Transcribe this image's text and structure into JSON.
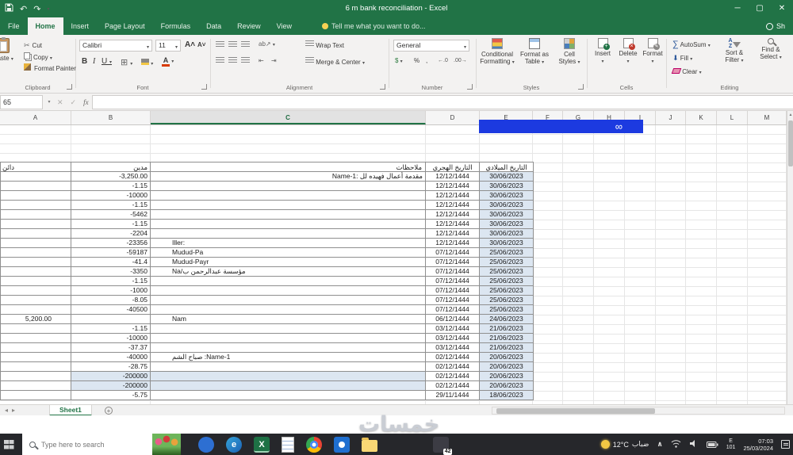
{
  "window": {
    "title": "6 m bank reconciliation - Excel",
    "share": "Sh"
  },
  "tabs": [
    "File",
    "Home",
    "Insert",
    "Page Layout",
    "Formulas",
    "Data",
    "Review",
    "View"
  ],
  "tell_me": "Tell me what you want to do...",
  "ribbon": {
    "clipboard": {
      "group": "Clipboard",
      "paste": "Paste",
      "cut": "Cut",
      "copy": "Copy",
      "format_painter": "Format Painter"
    },
    "font": {
      "group": "Font",
      "name": "Calibri",
      "size": "11"
    },
    "alignment": {
      "group": "Alignment",
      "wrap": "Wrap Text",
      "merge": "Merge & Center"
    },
    "number": {
      "group": "Number",
      "format": "General"
    },
    "styles": {
      "group": "Styles",
      "conditional_1": "Conditional",
      "conditional_2": "Formatting",
      "table_1": "Format as",
      "table_2": "Table",
      "cellstyles_1": "Cell",
      "cellstyles_2": "Styles"
    },
    "cells": {
      "group": "Cells",
      "insert": "Insert",
      "delete": "Delete",
      "format": "Format"
    },
    "editing": {
      "group": "Editing",
      "autosum": "AutoSum",
      "fill": "Fill",
      "clear": "Clear",
      "sort_1": "Sort &",
      "sort_2": "Filter",
      "find_1": "Find &",
      "find_2": "Select"
    }
  },
  "formula_bar": {
    "name_box": "65",
    "fx": "fx"
  },
  "grid": {
    "columns": [
      "A",
      "B",
      "C",
      "D",
      "E",
      "F",
      "G",
      "H",
      "I",
      "J",
      "K",
      "L",
      "M"
    ],
    "selected_column": "C",
    "shape_symbol": "∞",
    "shape_color": "#1c3ae0",
    "header": {
      "a": "دائن",
      "b": "مدين",
      "c": "ملاحظات",
      "d": "التاريخ الهجري",
      "e": "التاريخ الميلادي"
    },
    "rows": [
      {
        "a": "",
        "b": "-3,250.00",
        "c": "مقدمة أعمال فهيده لل :Name-1",
        "c_align": "right",
        "d": "12/12/1444",
        "e": "30/06/2023"
      },
      {
        "b": "-1.15",
        "d": "12/12/1444",
        "e": "30/06/2023"
      },
      {
        "b": "-10000",
        "d": "12/12/1444",
        "e": "30/06/2023"
      },
      {
        "b": "-1.15",
        "d": "12/12/1444",
        "e": "30/06/2023"
      },
      {
        "b": "-5462",
        "d": "12/12/1444",
        "e": "30/06/2023"
      },
      {
        "b": "-1.15",
        "d": "12/12/1444",
        "e": "30/06/2023"
      },
      {
        "b": "-2204",
        "d": "12/12/1444",
        "e": "30/06/2023"
      },
      {
        "b": "-23356",
        "c": "Iller:",
        "d": "12/12/1444",
        "e": "30/06/2023"
      },
      {
        "b": "-59187",
        "c": "Mudud-Pa",
        "d": "07/12/1444",
        "e": "25/06/2023"
      },
      {
        "b": "-41.4",
        "c": "Mudud-Payr",
        "d": "07/12/1444",
        "e": "25/06/2023"
      },
      {
        "b": "-3350",
        "c": "Na/مؤسسة عبدالرحمن ب",
        "d": "07/12/1444",
        "e": "25/06/2023"
      },
      {
        "b": "-1.15",
        "d": "07/12/1444",
        "e": "25/06/2023"
      },
      {
        "b": "-1000",
        "d": "07/12/1444",
        "e": "25/06/2023"
      },
      {
        "b": "-8.05",
        "d": "07/12/1444",
        "e": "25/06/2023"
      },
      {
        "b": "-40500",
        "d": "07/12/1444",
        "e": "25/06/2023"
      },
      {
        "a": "5,200.00",
        "b": "",
        "c": "Nam",
        "d": "06/12/1444",
        "e": "24/06/2023"
      },
      {
        "b": "-1.15",
        "d": "03/12/1444",
        "e": "21/06/2023"
      },
      {
        "b": "-10000",
        "d": "03/12/1444",
        "e": "21/06/2023"
      },
      {
        "b": "-37.37",
        "d": "03/12/1444",
        "e": "21/06/2023"
      },
      {
        "b": "-40000",
        "c": "صباح الشم :Name-1",
        "d": "02/12/1444",
        "e": "20/06/2023"
      },
      {
        "b": "-28.75",
        "d": "02/12/1444",
        "e": "20/06/2023"
      },
      {
        "b": "-200000",
        "d": "02/12/1444",
        "e": "20/06/2023",
        "hl": true
      },
      {
        "b": "-200000",
        "d": "02/12/1444",
        "e": "20/06/2023",
        "hl": true
      },
      {
        "b": "-5.75",
        "d": "29/11/1444",
        "e": "18/06/2023"
      }
    ]
  },
  "sheet_bar": {
    "tab": "Sheet1"
  },
  "watermark": "خمسات",
  "taskbar": {
    "search_placeholder": "Type here to search",
    "badge": "42",
    "weather_temp": "12°C",
    "weather_desc": "ضباب",
    "lang_line1": "E",
    "lang_line2": "101",
    "time": "07:03",
    "date": "25/03/2024"
  }
}
